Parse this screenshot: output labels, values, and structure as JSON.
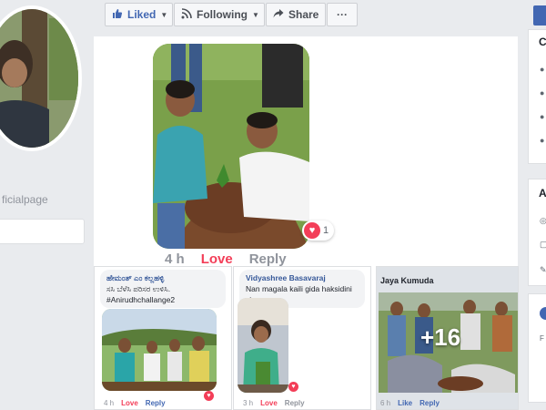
{
  "profile": {
    "page_handle": "ficialpage"
  },
  "action_bar": {
    "liked_label": "Liked",
    "following_label": "Following",
    "share_label": "Share",
    "more_label": "···"
  },
  "post": {
    "reaction_count": "1",
    "timestamp": "4 h",
    "love_label": "Love",
    "reply_label": "Reply"
  },
  "comments": [
    {
      "author": "ಹೇಮಂತ್ ಎಂ ಕಲ್ಲಹಳ್ಳಿ",
      "text": "ಸಸಿ ಬೆಳೆಸಿ ಪರಿಸರ ಉಳಿಸಿ.",
      "hashtag": "#Anirudhchallange2",
      "time": "4 h",
      "love": "Love",
      "reply": "Reply"
    },
    {
      "author": "Vidyashree Basavaraj",
      "text": "Nan magala kaili gida haksidini sir",
      "time": "3 h",
      "love": "Love",
      "reply": "Reply"
    },
    {
      "author": "Jaya Kumuda",
      "more_count": "+16",
      "time": "6 h",
      "like": "Like",
      "reply": "Reply"
    }
  ],
  "sidebar": {
    "card_a_letter": "C",
    "card_b_letter": "A",
    "card_c_text": "F"
  },
  "colors": {
    "brand": "#4267b2",
    "love": "#f33e58",
    "page_bg": "#e9ebee"
  },
  "icons": [
    "thumbs-up-icon",
    "rss-icon",
    "share-arrow-icon",
    "more-dots-icon",
    "heart-icon",
    "chevron-down-icon"
  ]
}
